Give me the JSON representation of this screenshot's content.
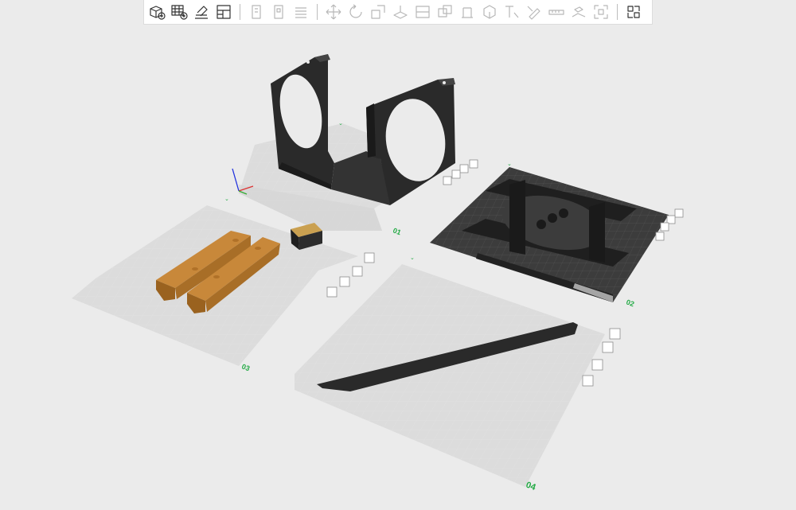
{
  "toolbar": {
    "groups": [
      [
        {
          "name": "add-object-icon",
          "enabled": true
        },
        {
          "name": "add-plate-icon",
          "enabled": true
        },
        {
          "name": "auto-orient-icon",
          "enabled": true
        },
        {
          "name": "arrange-icon",
          "enabled": true
        }
      ],
      [
        {
          "name": "split-to-objects-icon",
          "enabled": false
        },
        {
          "name": "split-to-parts-icon",
          "enabled": false
        },
        {
          "name": "layers-icon",
          "enabled": false
        }
      ],
      [
        {
          "name": "move-icon",
          "enabled": false
        },
        {
          "name": "rotate-icon",
          "enabled": false
        },
        {
          "name": "scale-icon",
          "enabled": false
        },
        {
          "name": "lay-on-face-icon",
          "enabled": false
        },
        {
          "name": "cut-icon",
          "enabled": false
        },
        {
          "name": "boolean-icon",
          "enabled": false
        },
        {
          "name": "support-paint-icon",
          "enabled": false
        },
        {
          "name": "seam-paint-icon",
          "enabled": false
        },
        {
          "name": "text-emboss-icon",
          "enabled": false
        },
        {
          "name": "color-paint-icon",
          "enabled": false
        },
        {
          "name": "measure-icon",
          "enabled": false
        },
        {
          "name": "assembly-icon",
          "enabled": false
        },
        {
          "name": "fit-view-icon",
          "enabled": false
        }
      ],
      [
        {
          "name": "explode-view-icon",
          "enabled": true
        }
      ]
    ]
  },
  "plates": [
    {
      "id": "01",
      "label": "01"
    },
    {
      "id": "02",
      "label": "02"
    },
    {
      "id": "03",
      "label": "03"
    },
    {
      "id": "04",
      "label": "04"
    }
  ],
  "colors": {
    "accent": "#22aa44",
    "model_dark": "#2a2a2a",
    "model_wood": "#b8792a",
    "plate_grid": "#d3d3d3",
    "textured_plate": "#3c3c3c"
  }
}
